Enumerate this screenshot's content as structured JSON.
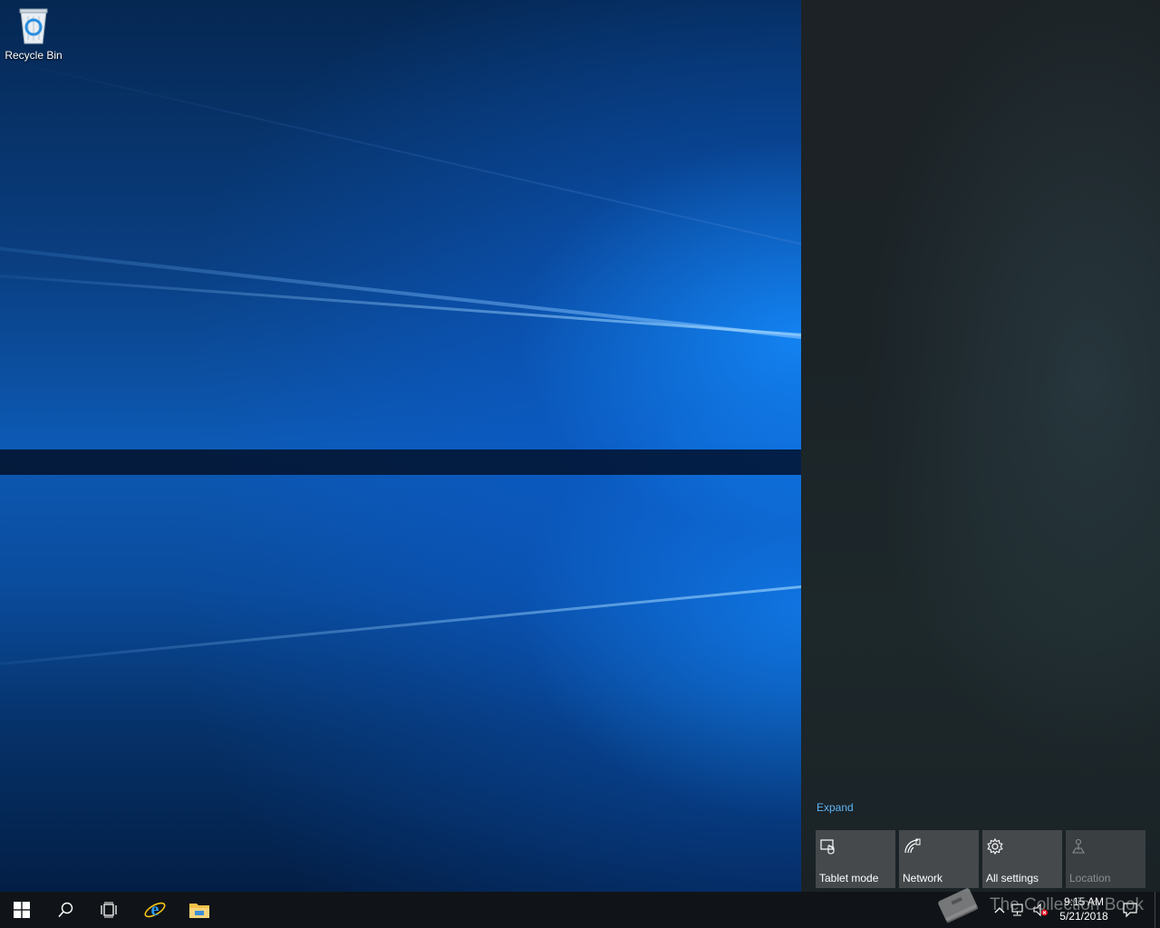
{
  "desktop": {
    "icons": [
      {
        "label": "Recycle Bin",
        "icon": "recycle-bin-icon"
      }
    ]
  },
  "action_center": {
    "expand_label": "Expand",
    "tiles": [
      {
        "label": "Tablet mode",
        "icon": "tablet-mode-icon",
        "enabled": true
      },
      {
        "label": "Network",
        "icon": "network-icon",
        "enabled": true
      },
      {
        "label": "All settings",
        "icon": "gear-icon",
        "enabled": true
      },
      {
        "label": "Location",
        "icon": "location-icon",
        "enabled": false
      }
    ]
  },
  "taskbar": {
    "buttons": [
      {
        "name": "start",
        "icon": "windows-logo-icon"
      },
      {
        "name": "search",
        "icon": "search-icon"
      },
      {
        "name": "task-view",
        "icon": "task-view-icon"
      },
      {
        "name": "internet-explorer",
        "icon": "internet-explorer-icon"
      },
      {
        "name": "file-explorer",
        "icon": "folder-icon"
      }
    ],
    "tray": {
      "icons": [
        "chevron-up-icon",
        "network-wired-icon",
        "volume-muted-icon"
      ],
      "time": "9:15 AM",
      "date": "5/21/2018",
      "notification_icon": "action-center-icon"
    }
  },
  "watermark": {
    "text": "The Collection Book"
  },
  "colors": {
    "link": "#5eb4f5",
    "tile": "#45494c",
    "taskbar": "#101418",
    "panel": "#1c2226"
  }
}
